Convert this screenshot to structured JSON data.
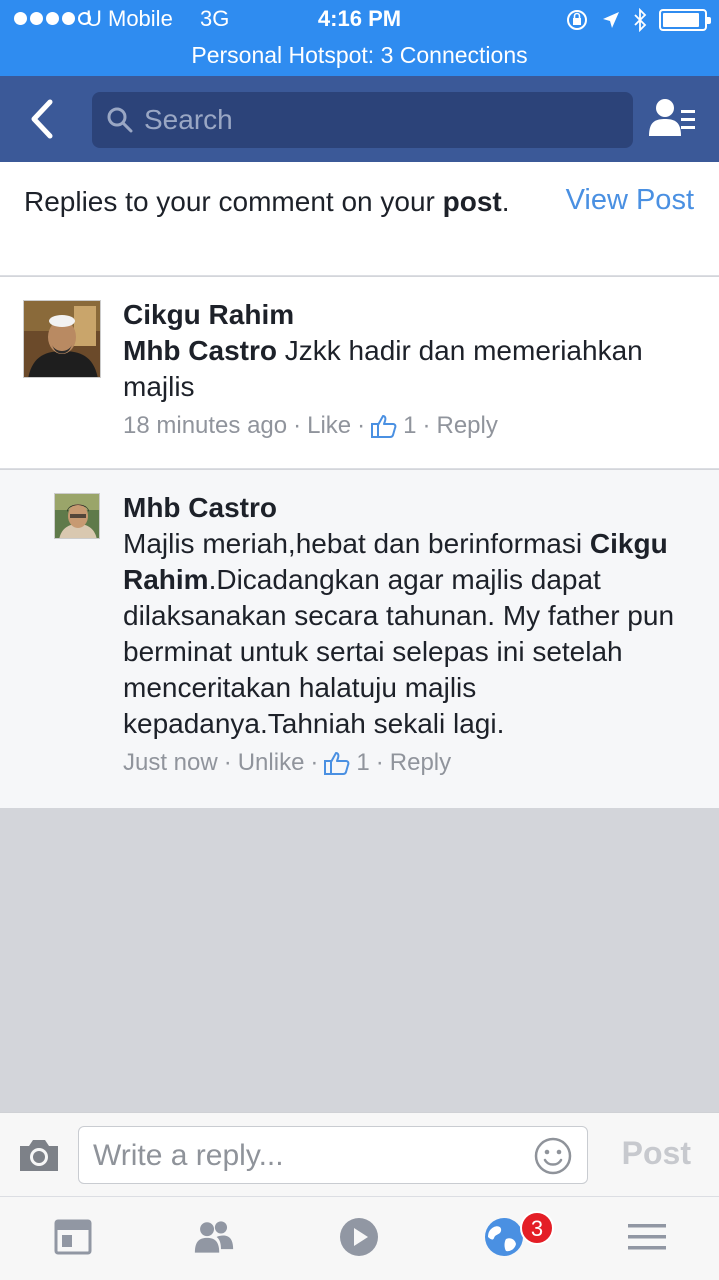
{
  "status_bar": {
    "carrier": "U Mobile",
    "network": "3G",
    "time": "4:16 PM",
    "hotspot": "Personal Hotspot: 3 Connections"
  },
  "nav": {
    "search_placeholder": "Search"
  },
  "header": {
    "text": "Replies to your comment on your",
    "bold_word": "post",
    "period": ".",
    "view_post_label": "View Post"
  },
  "comments": [
    {
      "author": "Cikgu Rahim",
      "mention": "Mhb Castro",
      "text": " Jzkk hadir dan memeriahkan majlis",
      "time": "18 minutes ago",
      "like_label": "Like",
      "like_count": "1",
      "reply_label": "Reply"
    },
    {
      "author": "Mhb Castro",
      "text_before": "Majlis meriah,hebat dan berinformasi ",
      "mention": "Cikgu Rahim",
      "text_after": ".Dicadangkan agar majlis dapat dilaksanakan secara tahunan. My father pun berminat  untuk sertai selepas ini setelah menceritakan halatuju majlis kepadanya.Tahniah sekali lagi.",
      "time": "Just now",
      "like_label": "Unlike",
      "like_count": "1",
      "reply_label": "Reply"
    }
  ],
  "reply_bar": {
    "placeholder": "Write a reply...",
    "post_label": "Post"
  },
  "tab_bar": {
    "notifications_badge": "3"
  },
  "colors": {
    "status_bar": "#2f8cf0",
    "nav_bar": "#3b5998",
    "link": "#4a90e2",
    "badge": "#e41e26"
  }
}
